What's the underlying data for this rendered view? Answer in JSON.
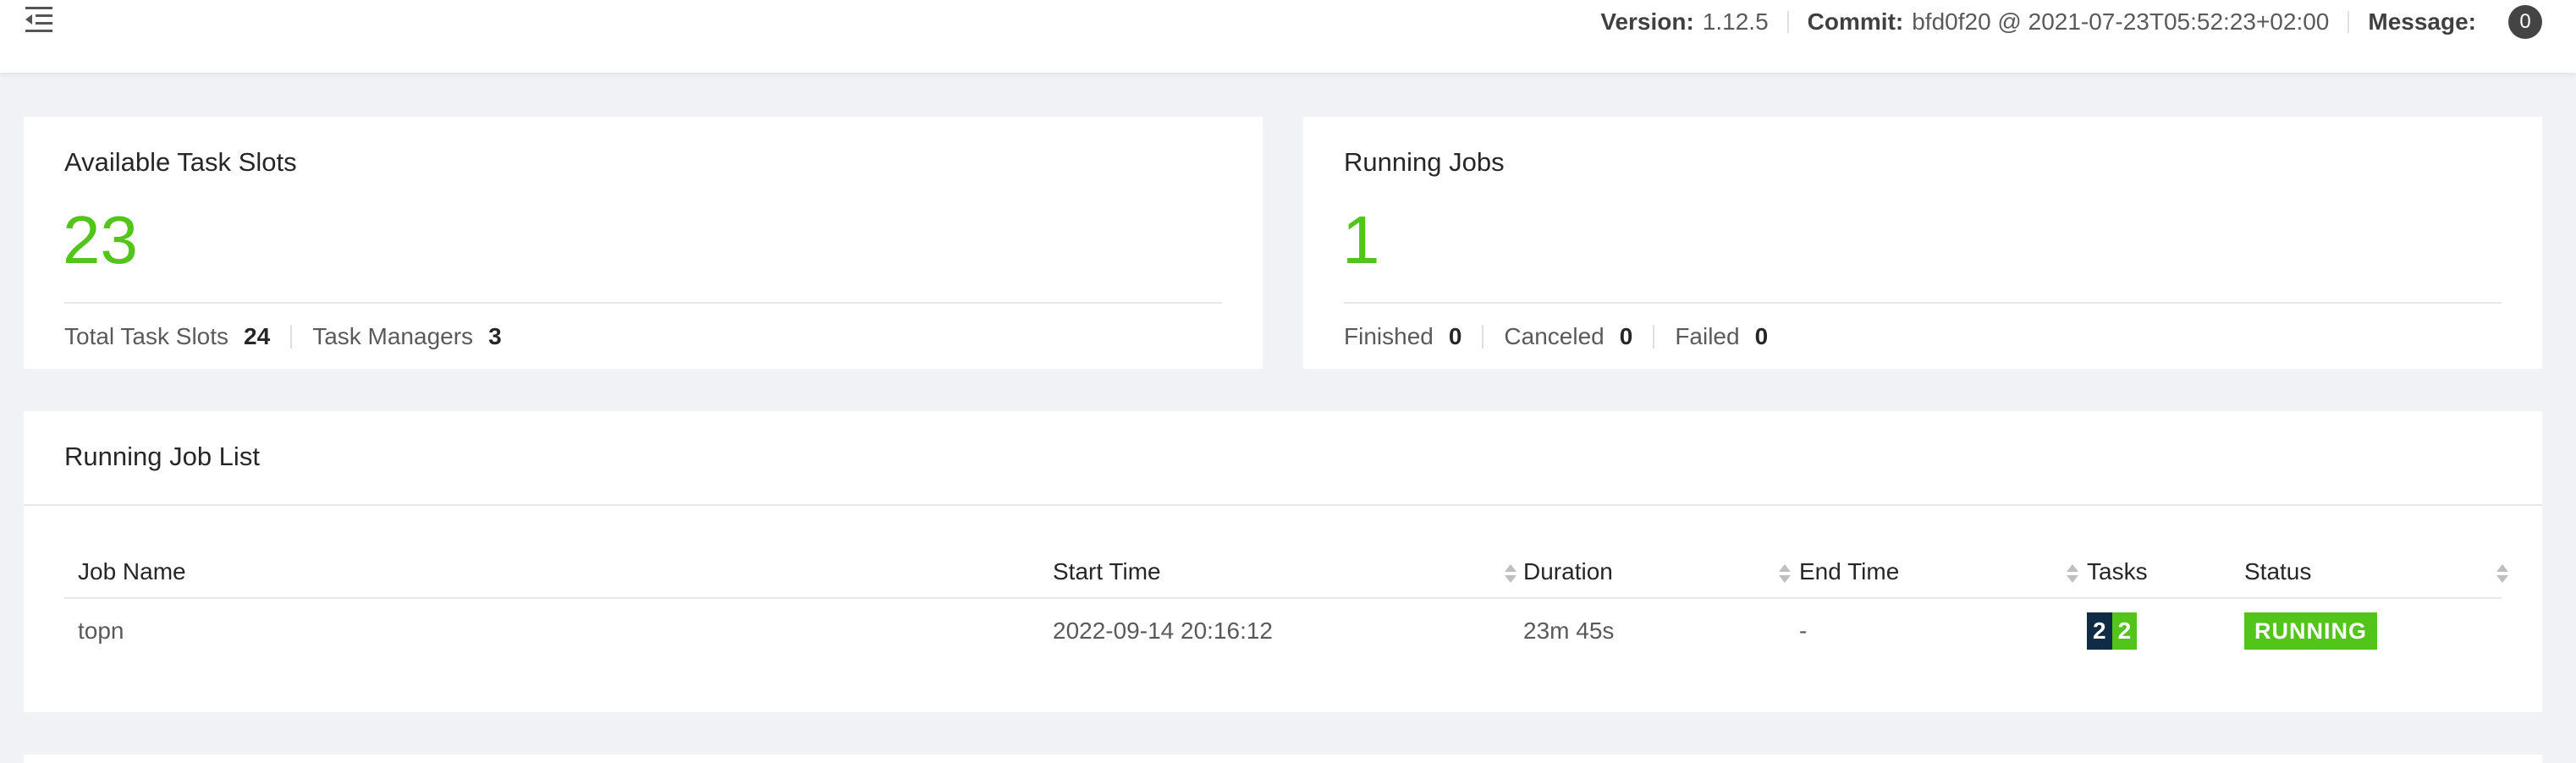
{
  "header": {
    "version_label": "Version:",
    "version_value": "1.12.5",
    "commit_label": "Commit:",
    "commit_value": "bfd0f20 @ 2021-07-23T05:52:23+02:00",
    "message_label": "Message:",
    "message_count": "0",
    "menu_icon": "menu-fold-icon"
  },
  "task_slots": {
    "title": "Available Task Slots",
    "available": "23",
    "total_label": "Total Task Slots",
    "total_value": "24",
    "managers_label": "Task Managers",
    "managers_value": "3"
  },
  "running_jobs": {
    "title": "Running Jobs",
    "count": "1",
    "finished_label": "Finished",
    "finished_value": "0",
    "canceled_label": "Canceled",
    "canceled_value": "0",
    "failed_label": "Failed",
    "failed_value": "0"
  },
  "job_list": {
    "title": "Running Job List",
    "columns": {
      "name": "Job Name",
      "start": "Start Time",
      "duration": "Duration",
      "end": "End Time",
      "tasks": "Tasks",
      "status": "Status"
    },
    "rows": [
      {
        "name": "topn",
        "start": "2022-09-14 20:16:12",
        "duration": "23m 45s",
        "end": "-",
        "tasks_total": "2",
        "tasks_running": "2",
        "status": "RUNNING"
      }
    ]
  },
  "colors": {
    "accent_green": "#52c41a",
    "task_total_bg": "#0f2b46",
    "page_bg": "#f0f2f5"
  }
}
